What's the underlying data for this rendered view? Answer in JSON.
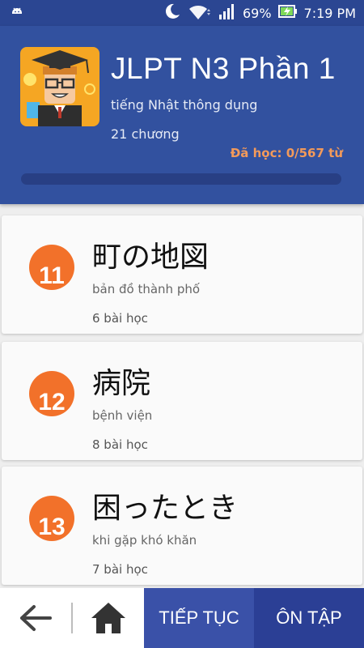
{
  "status_bar": {
    "battery": "69%",
    "time": "7:19 PM",
    "icons": [
      "android-icon",
      "moon-icon",
      "wifi-icon",
      "signal-icon",
      "battery-charging-icon"
    ]
  },
  "header": {
    "title": "JLPT N3 Phần 1",
    "subtitle": "tiếng Nhật thông dụng",
    "chapters": "21 chương",
    "learned": "Đã học: 0/567 từ",
    "progress": 0
  },
  "chapters": [
    {
      "number": "11",
      "title": "町の地図",
      "meaning": "bản đồ thành phố",
      "lessons": "6 bài học"
    },
    {
      "number": "12",
      "title": "病院",
      "meaning": "bệnh viện",
      "lessons": "8 bài học"
    },
    {
      "number": "13",
      "title": "困ったとき",
      "meaning": "khi gặp khó khăn",
      "lessons": "7 bài học"
    }
  ],
  "bottom_bar": {
    "continue_label": "TIẾP TỤC",
    "review_label": "ÔN TẬP"
  },
  "colors": {
    "header": "#32519f",
    "status_bar": "#2b4692",
    "accent": "#f2712a",
    "learned_text": "#f39a5a",
    "continue_button": "#3a51a8",
    "review_button": "#2b3f95"
  }
}
